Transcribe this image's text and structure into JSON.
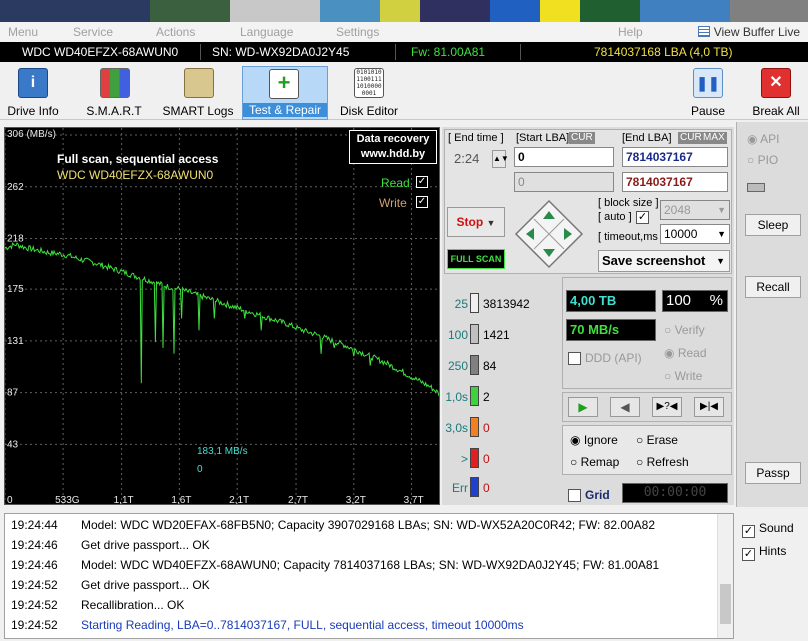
{
  "menu": {
    "items": [
      "Menu",
      "Service",
      "Actions",
      "Language",
      "Settings",
      "Help"
    ],
    "view_buffer": "View Buffer Live"
  },
  "drive": {
    "model": "WDC WD40EFZX-68AWUN0",
    "serial": "SN: WD-WX92DA0J2Y45",
    "firmware": "Fw: 81.00A81",
    "lba": "7814037168 LBA (4,0 TB)"
  },
  "toolbar": {
    "drive_info": "Drive Info",
    "smart": "S.M.A.R.T",
    "smart_logs": "SMART Logs",
    "test_repair": "Test & Repair",
    "disk_editor": "Disk Editor",
    "pause": "Pause",
    "break_all": "Break All"
  },
  "graph": {
    "unit_label": "306 (MB/s)",
    "title": "Full scan, sequential access",
    "model": "WDC WD40EFZX-68AWUN0",
    "logo_line1": "Data recovery",
    "logo_line2": "www.hdd.by",
    "read_label": "Read",
    "write_label": "Write",
    "current_speed": "183,1 MB/s",
    "zero": "0",
    "y_ticks": [
      "262",
      "218",
      "175",
      "131",
      "87",
      "43"
    ],
    "x_ticks": [
      "0",
      "533G",
      "1,1T",
      "1,6T",
      "2,1T",
      "2,7T",
      "3,2T",
      "3,7T"
    ]
  },
  "chart_data": {
    "type": "line",
    "title": "Full scan, sequential access",
    "ylabel": "(MB/s)",
    "ylim": [
      0,
      306
    ],
    "y_ticks": [
      43,
      87,
      131,
      175,
      218,
      262,
      306
    ],
    "x_ticks": [
      "0",
      "533G",
      "1,1T",
      "1,6T",
      "2,1T",
      "2,7T",
      "3,2T",
      "3,7T"
    ],
    "series": [
      {
        "name": "Read",
        "color": "#40e040",
        "x_tb": [
          0.0,
          0.1,
          0.2,
          0.3,
          0.4,
          0.5,
          0.6,
          0.7,
          0.8,
          0.9,
          1.0,
          1.1,
          1.2,
          1.3,
          1.4,
          1.5,
          1.6,
          1.7,
          1.8,
          1.9,
          2.0,
          2.1,
          2.2,
          2.3,
          2.4,
          2.5,
          2.6,
          2.7,
          2.8,
          2.9,
          3.0,
          3.1,
          3.2,
          3.3,
          3.4,
          3.5,
          3.6,
          3.7,
          3.8,
          3.9,
          4.0
        ],
        "values": [
          210,
          213,
          210,
          208,
          206,
          205,
          203,
          200,
          198,
          195,
          192,
          189,
          186,
          183,
          180,
          177,
          175,
          172,
          169,
          166,
          163,
          160,
          157,
          154,
          151,
          148,
          145,
          141,
          138,
          135,
          131,
          128,
          124,
          120,
          116,
          112,
          107,
          102,
          97,
          92,
          85
        ]
      }
    ]
  },
  "control": {
    "end_time_label": "[ End time ]",
    "end_time": "2:24",
    "start_lba_label": "[Start LBA]",
    "cur_tag": "CUR",
    "end_lba_label": "[End LBA]",
    "max_tag": "MAX",
    "start_lba": "0",
    "start_lba_cur": "0",
    "end_lba": "7814037167",
    "end_lba_cur": "7814037167",
    "stop_label": "Stop",
    "full_scan_label": "FULL SCAN",
    "block_size_label": "[ block size ]",
    "auto_label": "[ auto ]",
    "block_size_value": "2048",
    "timeout_label": "[ timeout,ms ]",
    "timeout_value": "10000",
    "save_screenshot": "Save screenshot"
  },
  "stats": {
    "rows": [
      {
        "label": "25",
        "count": "3813942",
        "color": "#f0f0f0"
      },
      {
        "label": "100",
        "count": "1421",
        "color": "#c0c0c0"
      },
      {
        "label": "250",
        "count": "84",
        "color": "#808080"
      },
      {
        "label": "1,0s",
        "count": "2",
        "color": "#40d040"
      },
      {
        "label": "3,0s",
        "count": "0",
        "color": "#f08020"
      },
      {
        "label": ">",
        "count": "0",
        "color": "#e02020"
      },
      {
        "label": "Err",
        "count": "0",
        "color": "#2040d0"
      }
    ],
    "total_size": "4,00 TB",
    "percent_value": "100",
    "percent_sign": "%",
    "speed": "70 MB/s",
    "ddd_label": "DDD (API)",
    "verify_label": "Verify",
    "read_label": "Read",
    "write_label": "Write",
    "ignore_label": "Ignore",
    "erase_label": "Erase",
    "remap_label": "Remap",
    "refresh_label": "Refresh",
    "grid_label": "Grid",
    "timer": "00:00:00"
  },
  "right": {
    "api_label": "API",
    "pio_label": "PIO",
    "sleep": "Sleep",
    "recall": "Recall",
    "passp": "Passp"
  },
  "log": {
    "rows": [
      {
        "time": "19:24:44",
        "text": "Model: WDC WD20EFAX-68FB5N0; Capacity 3907029168 LBAs; SN: WD-WX52A20C0R42; FW: 82.00A82",
        "color": "#000000"
      },
      {
        "time": "19:24:46",
        "text": "Get drive passport... OK",
        "color": "#000000"
      },
      {
        "time": "19:24:46",
        "text": "Model: WDC WD40EFZX-68AWUN0; Capacity 7814037168 LBAs; SN: WD-WX92DA0J2Y45; FW: 81.00A81",
        "color": "#000000"
      },
      {
        "time": "19:24:52",
        "text": "Get drive passport... OK",
        "color": "#000000"
      },
      {
        "time": "19:24:52",
        "text": "Recallibration... OK",
        "color": "#000000"
      },
      {
        "time": "19:24:52",
        "text": "Starting Reading, LBA=0..7814037167, FULL, sequential access, timeout 10000ms",
        "color": "#1a3bb8"
      }
    ]
  },
  "options": {
    "sound": "Sound",
    "hints": "Hints"
  }
}
